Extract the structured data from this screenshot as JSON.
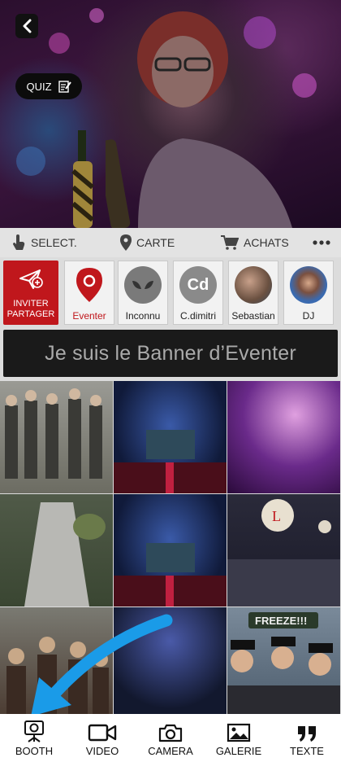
{
  "header": {
    "quiz_label": "QUIZ"
  },
  "actions": {
    "select_label": "SELECT.",
    "map_label": "CARTE",
    "purchases_label": "ACHATS"
  },
  "invite": {
    "line1": "INVITER",
    "line2": "PARTAGER"
  },
  "contacts": [
    {
      "name": "Eventer",
      "initials": ""
    },
    {
      "name": "Inconnu",
      "initials": ""
    },
    {
      "name": "C.dimitri",
      "initials": "Cd"
    },
    {
      "name": "Sebastian",
      "initials": ""
    },
    {
      "name": "DJ",
      "initials": ""
    }
  ],
  "banner": {
    "text": "Je suis le Banner d’Eventer"
  },
  "grid": {
    "freeze_sign": "FREEZE!!!"
  },
  "nav": {
    "items": [
      {
        "label": "BOOTH",
        "icon": "booth-icon"
      },
      {
        "label": "VIDEO",
        "icon": "video-icon"
      },
      {
        "label": "CAMERA",
        "icon": "camera-icon"
      },
      {
        "label": "GALERIE",
        "icon": "gallery-icon"
      },
      {
        "label": "TEXTE",
        "icon": "quote-icon"
      }
    ]
  },
  "colors": {
    "invite_bg": "#c0171c",
    "eventer_accent": "#c0171c",
    "arrow": "#1a9be8"
  }
}
